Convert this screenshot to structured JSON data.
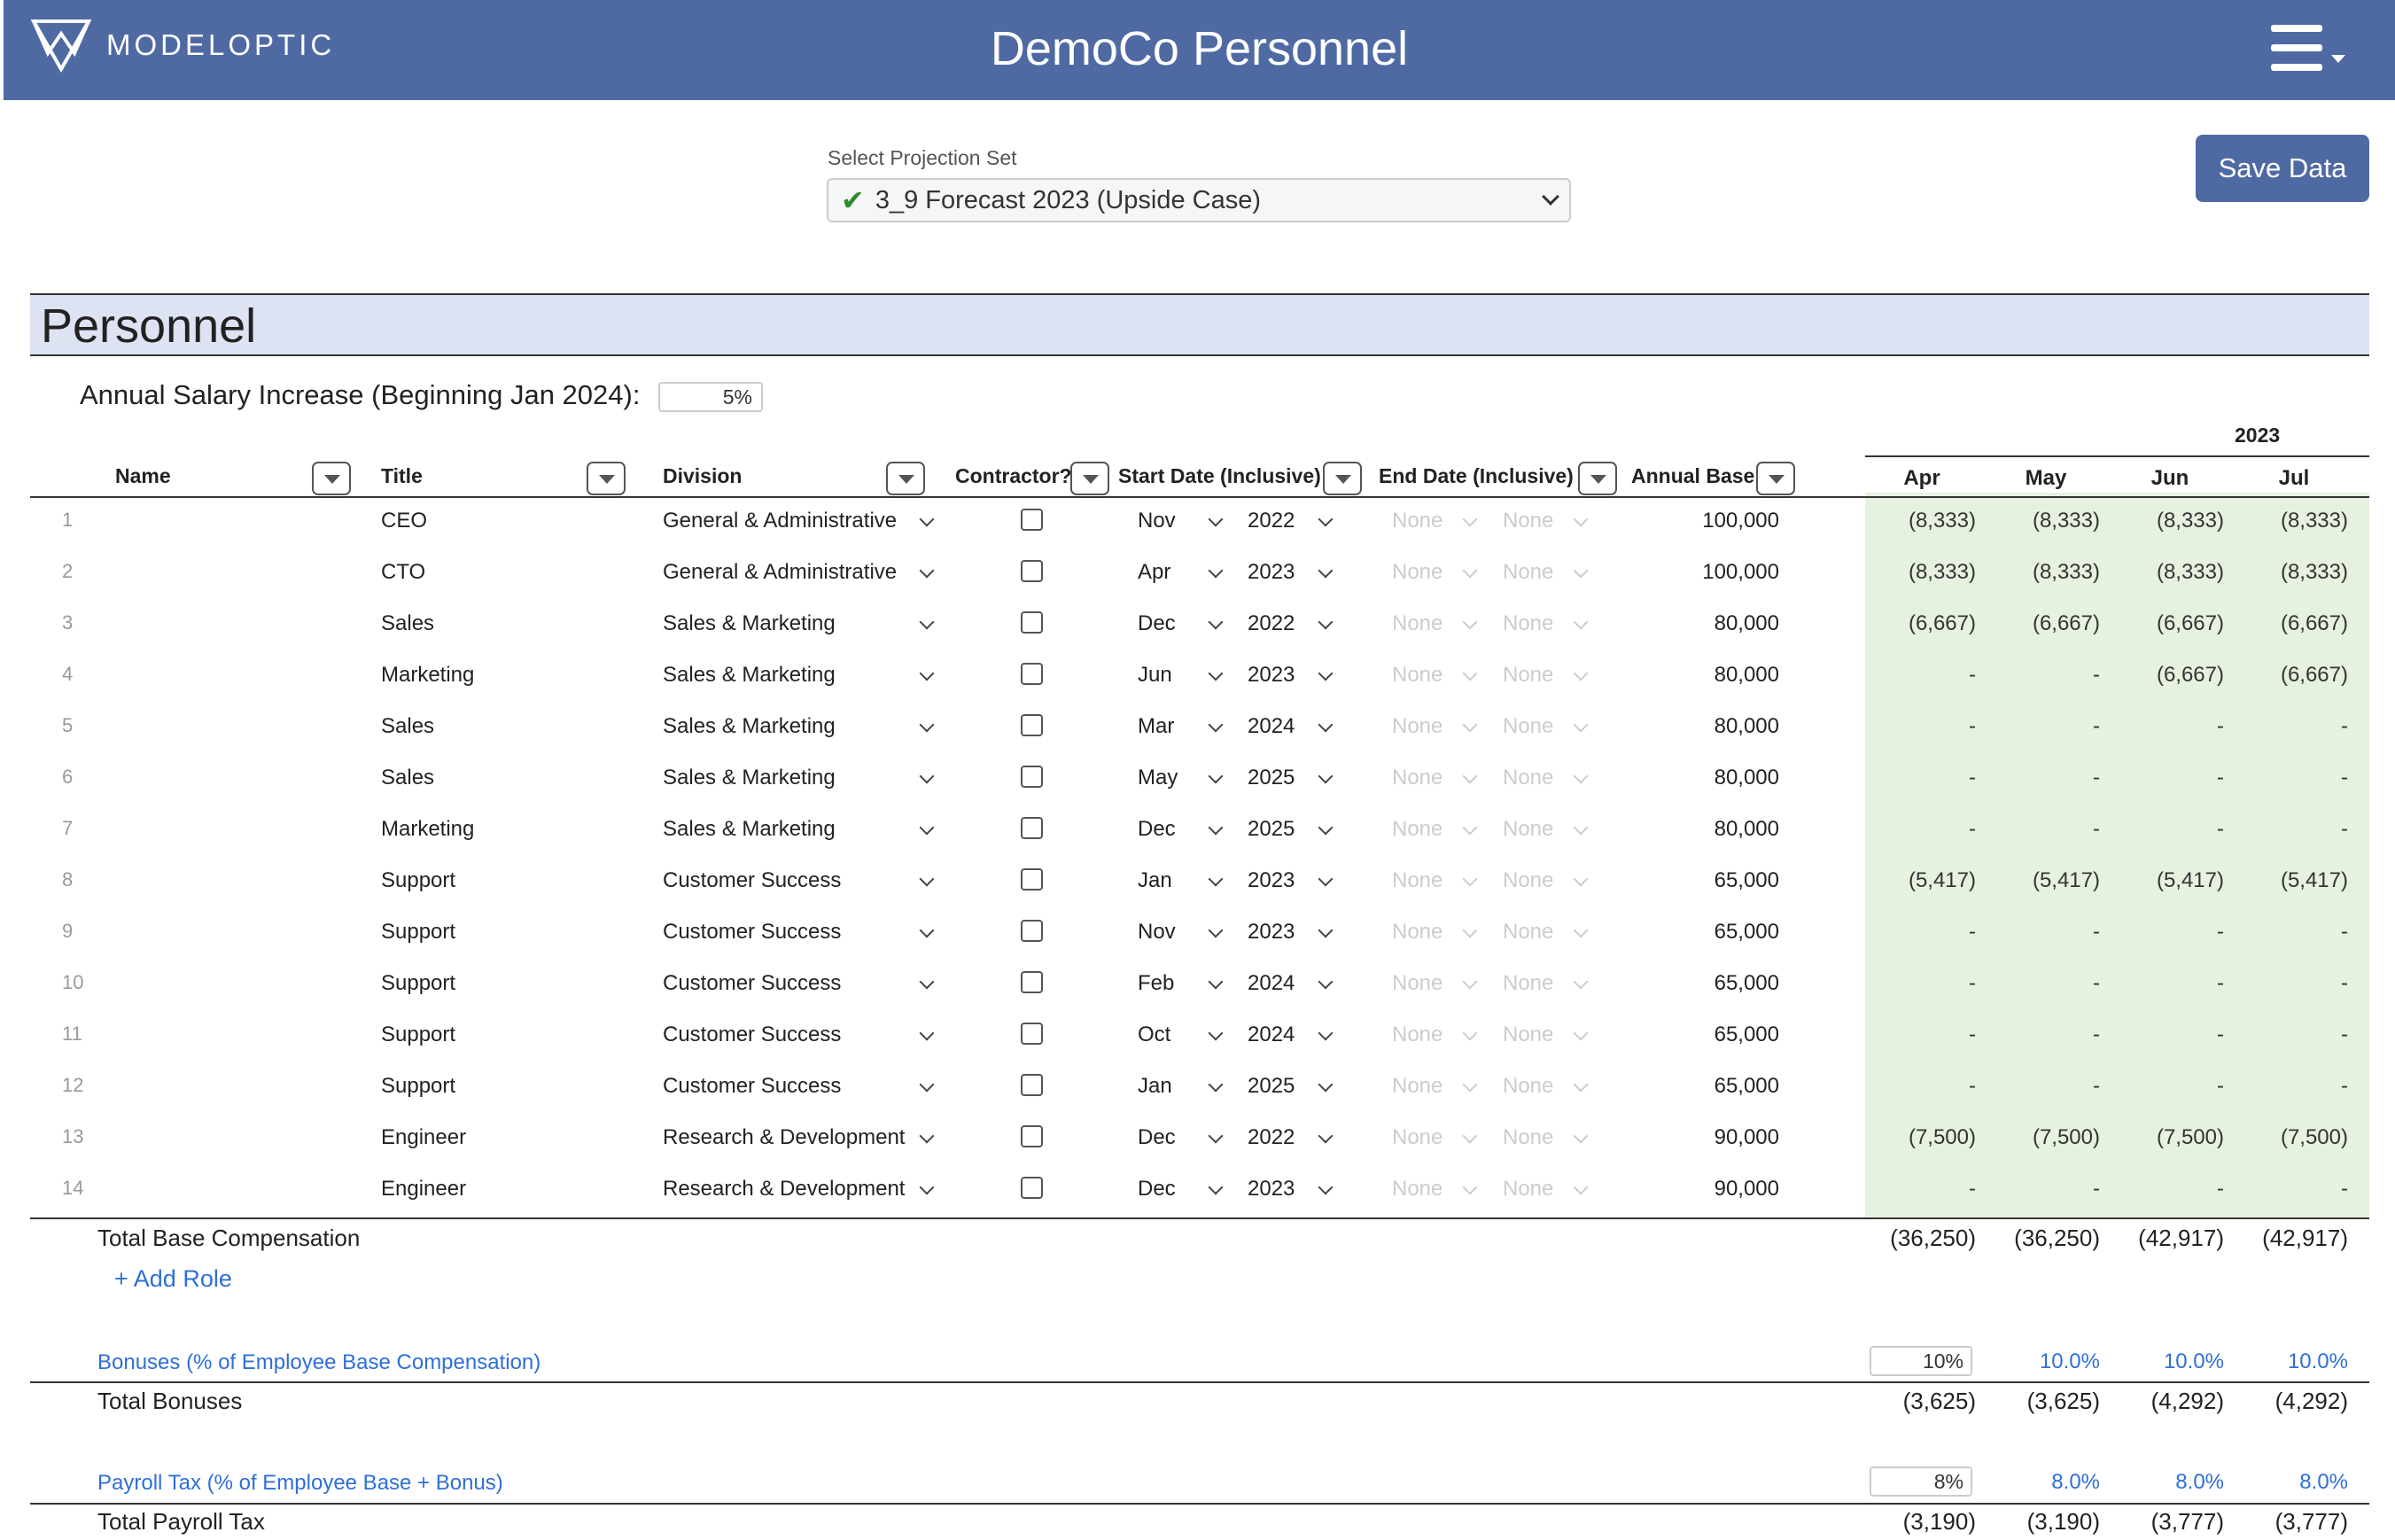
{
  "header": {
    "logo_text": "MODELOPTIC",
    "app_title": "DemoCo Personnel"
  },
  "projection": {
    "label": "Select Projection Set",
    "selected": "3_9 Forecast 2023 (Upside Case)"
  },
  "save_label": "Save Data",
  "section_title": "Personnel",
  "salary_increase": {
    "label": "Annual Salary Increase (Beginning Jan 2024):",
    "value": "5%"
  },
  "table": {
    "year": "2023",
    "columns": {
      "name": "Name",
      "title": "Title",
      "division": "Division",
      "contractor": "Contractor?",
      "start": "Start Date (Inclusive)",
      "end": "End Date (Inclusive)",
      "base": "Annual Base"
    },
    "months": [
      "Apr",
      "May",
      "Jun",
      "Jul"
    ],
    "rows": [
      {
        "idx": "1",
        "title": "CEO",
        "division": "General & Administrative",
        "smon": "Nov",
        "syr": "2022",
        "emon": "None",
        "eyr": "None",
        "base": "100,000",
        "m": [
          "(8,333)",
          "(8,333)",
          "(8,333)",
          "(8,333)"
        ]
      },
      {
        "idx": "2",
        "title": "CTO",
        "division": "General & Administrative",
        "smon": "Apr",
        "syr": "2023",
        "emon": "None",
        "eyr": "None",
        "base": "100,000",
        "m": [
          "(8,333)",
          "(8,333)",
          "(8,333)",
          "(8,333)"
        ]
      },
      {
        "idx": "3",
        "title": "Sales",
        "division": "Sales & Marketing",
        "smon": "Dec",
        "syr": "2022",
        "emon": "None",
        "eyr": "None",
        "base": "80,000",
        "m": [
          "(6,667)",
          "(6,667)",
          "(6,667)",
          "(6,667)"
        ]
      },
      {
        "idx": "4",
        "title": "Marketing",
        "division": "Sales & Marketing",
        "smon": "Jun",
        "syr": "2023",
        "emon": "None",
        "eyr": "None",
        "base": "80,000",
        "m": [
          "-",
          "-",
          "(6,667)",
          "(6,667)"
        ]
      },
      {
        "idx": "5",
        "title": "Sales",
        "division": "Sales & Marketing",
        "smon": "Mar",
        "syr": "2024",
        "emon": "None",
        "eyr": "None",
        "base": "80,000",
        "m": [
          "-",
          "-",
          "-",
          "-"
        ]
      },
      {
        "idx": "6",
        "title": "Sales",
        "division": "Sales & Marketing",
        "smon": "May",
        "syr": "2025",
        "emon": "None",
        "eyr": "None",
        "base": "80,000",
        "m": [
          "-",
          "-",
          "-",
          "-"
        ]
      },
      {
        "idx": "7",
        "title": "Marketing",
        "division": "Sales & Marketing",
        "smon": "Dec",
        "syr": "2025",
        "emon": "None",
        "eyr": "None",
        "base": "80,000",
        "m": [
          "-",
          "-",
          "-",
          "-"
        ]
      },
      {
        "idx": "8",
        "title": "Support",
        "division": "Customer Success",
        "smon": "Jan",
        "syr": "2023",
        "emon": "None",
        "eyr": "None",
        "base": "65,000",
        "m": [
          "(5,417)",
          "(5,417)",
          "(5,417)",
          "(5,417)"
        ]
      },
      {
        "idx": "9",
        "title": "Support",
        "division": "Customer Success",
        "smon": "Nov",
        "syr": "2023",
        "emon": "None",
        "eyr": "None",
        "base": "65,000",
        "m": [
          "-",
          "-",
          "-",
          "-"
        ]
      },
      {
        "idx": "10",
        "title": "Support",
        "division": "Customer Success",
        "smon": "Feb",
        "syr": "2024",
        "emon": "None",
        "eyr": "None",
        "base": "65,000",
        "m": [
          "-",
          "-",
          "-",
          "-"
        ]
      },
      {
        "idx": "11",
        "title": "Support",
        "division": "Customer Success",
        "smon": "Oct",
        "syr": "2024",
        "emon": "None",
        "eyr": "None",
        "base": "65,000",
        "m": [
          "-",
          "-",
          "-",
          "-"
        ]
      },
      {
        "idx": "12",
        "title": "Support",
        "division": "Customer Success",
        "smon": "Jan",
        "syr": "2025",
        "emon": "None",
        "eyr": "None",
        "base": "65,000",
        "m": [
          "-",
          "-",
          "-",
          "-"
        ]
      },
      {
        "idx": "13",
        "title": "Engineer",
        "division": "Research & Development",
        "smon": "Dec",
        "syr": "2022",
        "emon": "None",
        "eyr": "None",
        "base": "90,000",
        "m": [
          "(7,500)",
          "(7,500)",
          "(7,500)",
          "(7,500)"
        ]
      },
      {
        "idx": "14",
        "title": "Engineer",
        "division": "Research & Development",
        "smon": "Dec",
        "syr": "2023",
        "emon": "None",
        "eyr": "None",
        "base": "90,000",
        "m": [
          "-",
          "-",
          "-",
          "-"
        ]
      }
    ]
  },
  "totals": {
    "base": {
      "label": "Total Base Compensation",
      "values": [
        "(36,250)",
        "(36,250)",
        "(42,917)",
        "(42,917)"
      ]
    },
    "add_role": "+ Add Role",
    "bonus_pct": {
      "label": "Bonuses (% of Employee Base Compensation)",
      "input": "10%",
      "values": [
        "10.0%",
        "10.0%",
        "10.0%"
      ]
    },
    "bonus": {
      "label": "Total Bonuses",
      "values": [
        "(3,625)",
        "(3,625)",
        "(4,292)",
        "(4,292)"
      ]
    },
    "tax_pct": {
      "label": "Payroll Tax (% of Employee Base + Bonus)",
      "input": "8%",
      "values": [
        "8.0%",
        "8.0%",
        "8.0%"
      ]
    },
    "tax": {
      "label": "Total Payroll Tax",
      "values": [
        "(3,190)",
        "(3,190)",
        "(3,777)",
        "(3,777)"
      ]
    }
  }
}
